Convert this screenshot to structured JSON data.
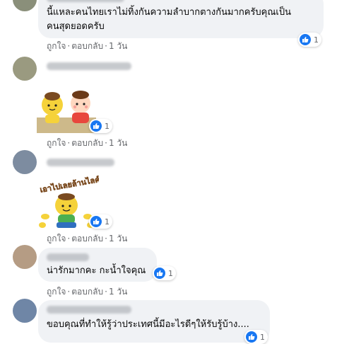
{
  "comments": [
    {
      "id": "c1",
      "text_lines": [
        "นี้แหละคนไทยเราไม่ทิ้งกันความลำบากตางกันมากครับคุณเป็น",
        "คนสุดยอดครับ"
      ],
      "reaction_count": "1",
      "actions": {
        "like": "ถูกใจ",
        "reply": "ตอบกลับ",
        "time": "1 วัน"
      }
    },
    {
      "id": "c2",
      "type": "sticker",
      "reaction_count": "1",
      "actions": {
        "like": "ถูกใจ",
        "reply": "ตอบกลับ",
        "time": "1 วัน"
      }
    },
    {
      "id": "c3",
      "type": "sticker",
      "sticker_text": "เอาไปเลยล้านไลค์",
      "reaction_count": "1",
      "actions": {
        "like": "ถูกใจ",
        "reply": "ตอบกลับ",
        "time": "1 วัน"
      }
    },
    {
      "id": "c4",
      "text_lines": [
        "น่ารักมากคะ กะน้ำใจคุณ"
      ],
      "reaction_count": "1",
      "actions": {
        "like": "ถูกใจ",
        "reply": "ตอบกลับ",
        "time": "1 วัน"
      }
    },
    {
      "id": "c5",
      "text_lines": [
        "ขอบคุณที่ทำให้รู้ว่าประเทศนี้มีอะไรดีๆให้รับรู้บ้าง...."
      ],
      "reaction_count": "1"
    }
  ],
  "separator": "·",
  "colors": {
    "like_blue": "#1877f2",
    "bubble": "#f0f2f5",
    "meta_text": "#65676b"
  },
  "icons": {
    "like": "thumbs-up-icon"
  }
}
